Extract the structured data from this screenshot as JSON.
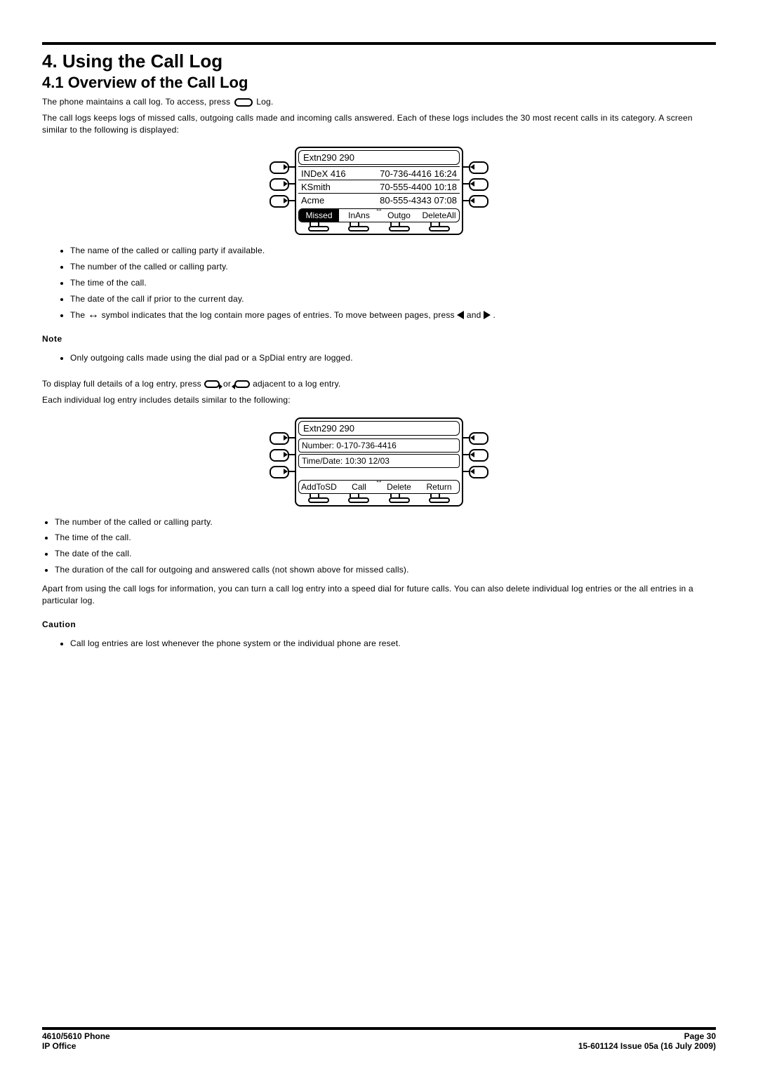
{
  "document": {
    "section_heading": "4. Using the Call Log",
    "subsection_heading": "4.1 Overview of the Call Log",
    "p1a": "The phone maintains a call log. To access, press ",
    "p1b": " Log.",
    "p2": "The call logs keeps logs of missed calls, outgoing calls made and incoming calls answered. Each of these logs includes the 30 most recent calls in its category. A screen similar to the following is displayed:",
    "bullets1": {
      "b1": "The name of the called or calling party if available.",
      "b2": "The number of the called or calling party.",
      "b3": "The time of the call.",
      "b4": "The date of the call if prior to the current day.",
      "b5a": "The ",
      "b5b": " symbol indicates that the log contain more pages of entries. To move between pages, press ",
      "b5c": " and ",
      "b5d": "."
    },
    "note_label": "Note",
    "note_bullet": "Only outgoing calls made using the dial pad or a SpDial entry are logged.",
    "p3a": "To display full details of a log entry, press ",
    "p3b": " or ",
    "p3c": " adjacent to a log entry.",
    "p4": "Each individual log entry includes details similar to the following:",
    "bullets2": {
      "b1": "The number of the called or calling party.",
      "b2": "The time of the call.",
      "b3": "The date of the call.",
      "b4": "The duration of the call for outgoing and answered calls (not shown above for missed calls)."
    },
    "p5": "Apart from using the call logs for information, you can turn a call log entry into a speed dial for future calls. You can also delete individual log entries or the all entries in a particular log.",
    "caution_label": "Caution",
    "caution_bullet": "Call log entries are lost whenever the phone system or the individual phone are reset."
  },
  "diagram1": {
    "title": "Extn290 290",
    "rows": [
      {
        "name": "INDeX 416",
        "detail": "70-736-4416 16:24"
      },
      {
        "name": "KSmith",
        "detail": "70-555-4400 10:18"
      },
      {
        "name": "Acme",
        "detail": "80-555-4343 07:08"
      }
    ],
    "softkeys": {
      "k1": "Missed",
      "k2": "InAns",
      "k3": "Outgo",
      "k4": "DeleteAll"
    }
  },
  "diagram2": {
    "title": "Extn290 290",
    "line1": "Number: 0-170-736-4416",
    "line2": "Time/Date: 10:30 12/03",
    "softkeys": {
      "k1": "AddToSD",
      "k2": "Call",
      "k3": "Delete",
      "k4": "Return"
    }
  },
  "footer": {
    "left1": "4610/5610 Phone",
    "left2": "IP Office",
    "right1": "Page 30",
    "right2": "15-601124 Issue 05a (16 July 2009)"
  }
}
